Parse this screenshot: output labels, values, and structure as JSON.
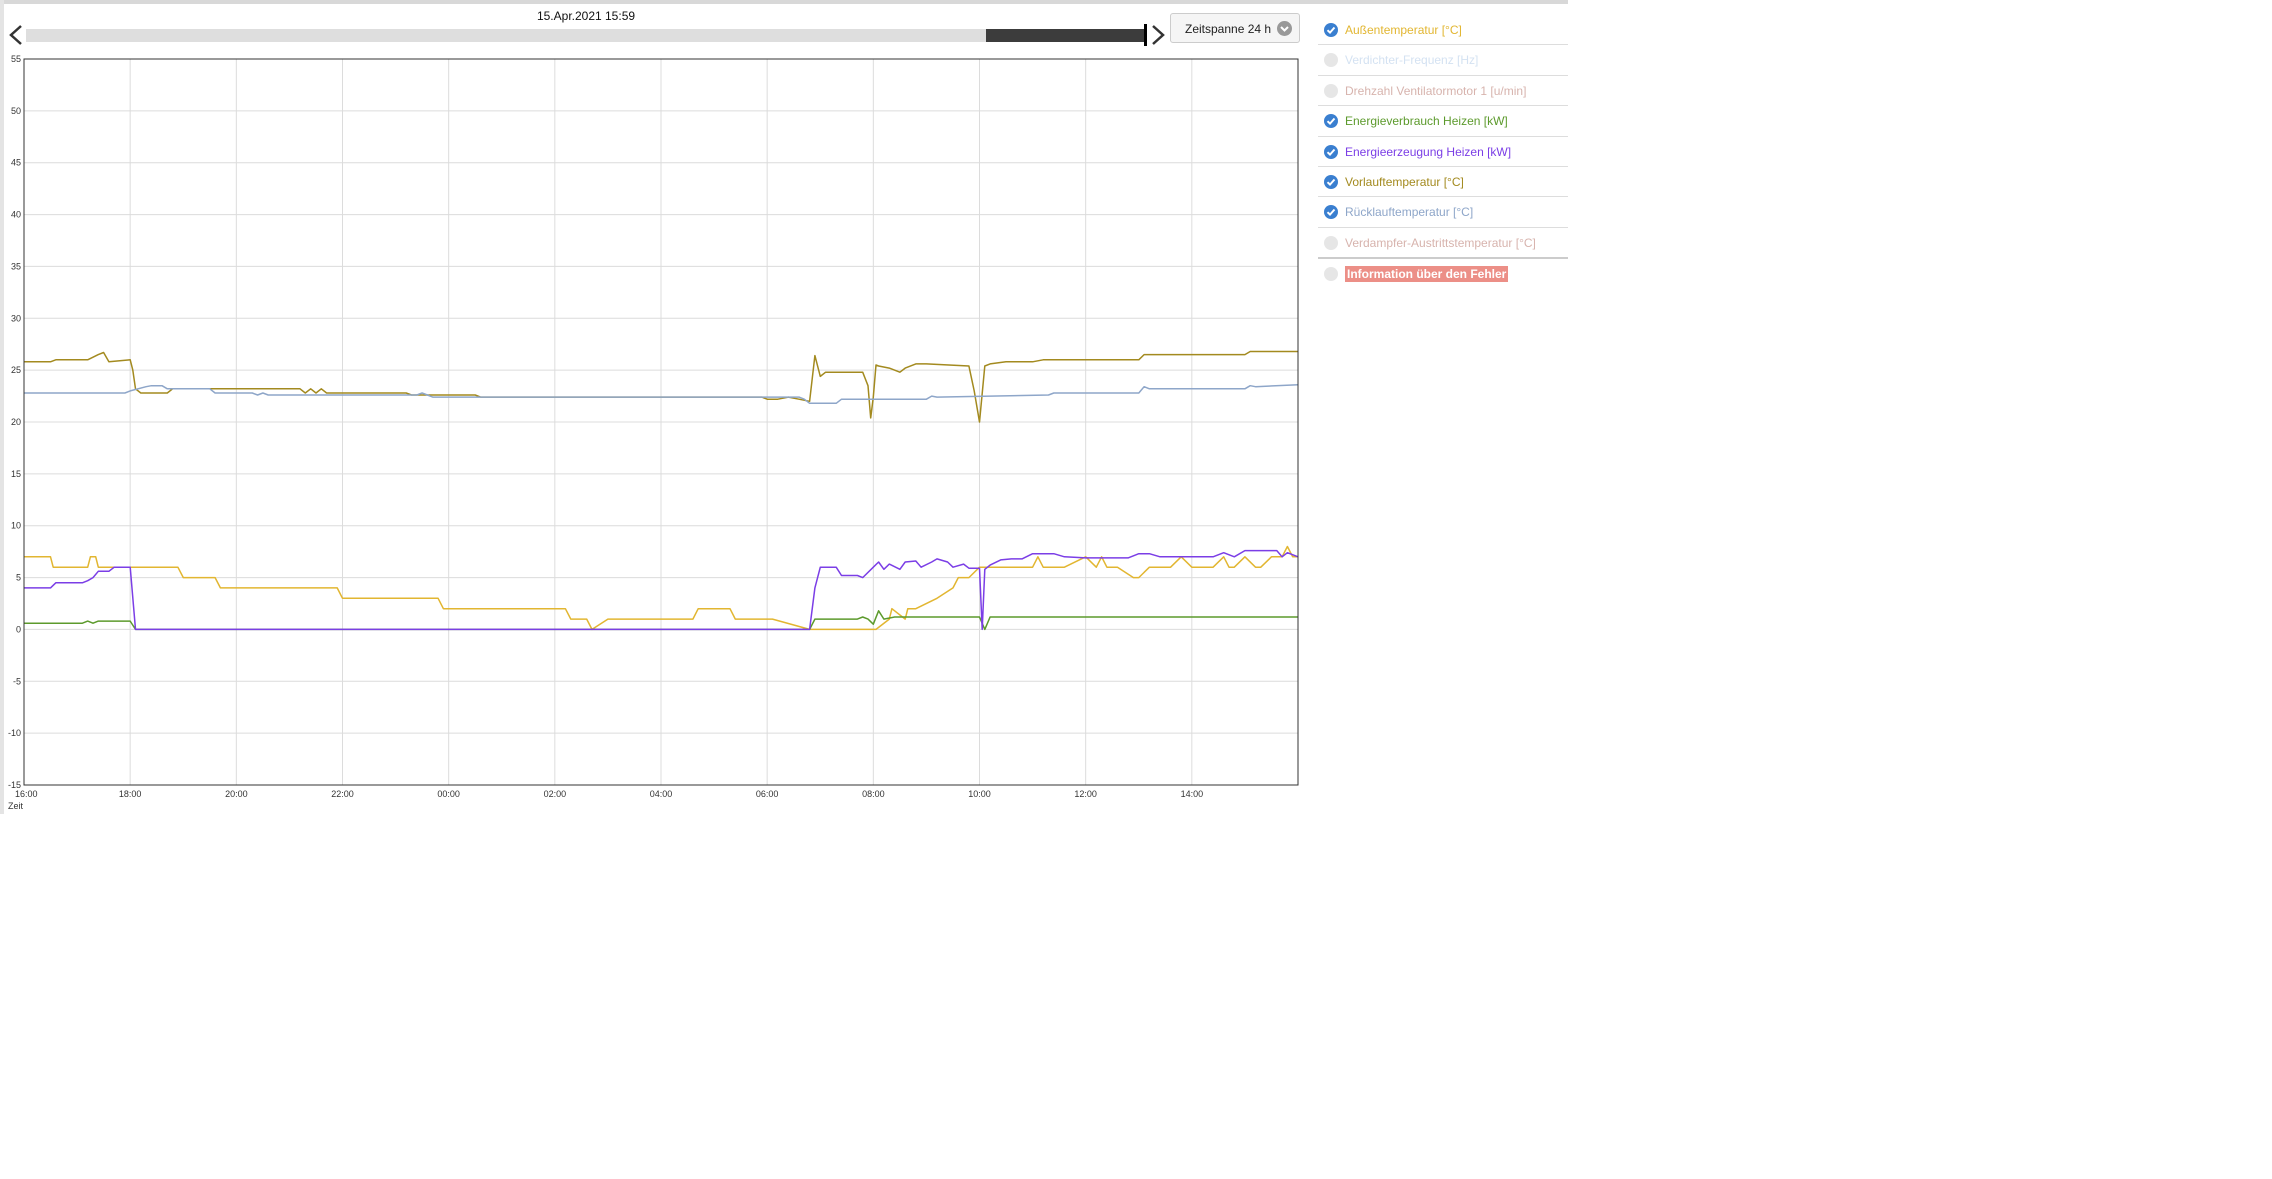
{
  "header": {
    "date_label": "15.Apr.2021 15:59",
    "timespan_label": "Zeitspanne 24 h"
  },
  "slider": {
    "window_start_fraction": 0.857,
    "window_end_fraction": 1.0
  },
  "legend": [
    {
      "label": "Außentemperatur [°C]",
      "checked": true,
      "color": "#e2b631"
    },
    {
      "label": "Verdichter-Frequenz [Hz]",
      "checked": false,
      "color": "#d4e2f2"
    },
    {
      "label": "Drehzahl Ventilatormotor 1 [u/min]",
      "checked": false,
      "color": "#d7b3ad"
    },
    {
      "label": "Energieverbrauch Heizen [kW]",
      "checked": true,
      "color": "#5c9a2c"
    },
    {
      "label": "Energieerzeugung Heizen [kW]",
      "checked": true,
      "color": "#7b3ee6"
    },
    {
      "label": "Vorlauftemperatur [°C]",
      "checked": true,
      "color": "#a38a1f"
    },
    {
      "label": "Rücklauftemperatur [°C]",
      "checked": true,
      "color": "#8ea6c9"
    },
    {
      "label": "Verdampfer-Austrittstemperatur [°C]",
      "checked": false,
      "color": "#d7b3ad"
    },
    {
      "label": "Information über den Fehler",
      "checked": false,
      "color": "#ec8f87",
      "badge": true
    }
  ],
  "chart_data": {
    "type": "line",
    "xlabel": "Zeit",
    "ylim": [
      -15,
      55
    ],
    "yticks": [
      -15,
      -10,
      -5,
      0,
      5,
      10,
      15,
      20,
      25,
      30,
      35,
      40,
      45,
      50,
      55
    ],
    "xlim": [
      0,
      24
    ],
    "xticks": [
      {
        "pos": 0,
        "label": "16:00"
      },
      {
        "pos": 2,
        "label": "18:00"
      },
      {
        "pos": 4,
        "label": "20:00"
      },
      {
        "pos": 6,
        "label": "22:00"
      },
      {
        "pos": 8,
        "label": "00:00"
      },
      {
        "pos": 10,
        "label": "02:00"
      },
      {
        "pos": 12,
        "label": "04:00"
      },
      {
        "pos": 14,
        "label": "06:00"
      },
      {
        "pos": 16,
        "label": "08:00"
      },
      {
        "pos": 18,
        "label": "10:00"
      },
      {
        "pos": 20,
        "label": "12:00"
      },
      {
        "pos": 22,
        "label": "14:00"
      }
    ],
    "grid": true,
    "series": [
      {
        "name": "Außentemperatur [°C]",
        "color": "#e2b631",
        "x": [
          0,
          0.5,
          0.55,
          1.2,
          1.25,
          1.35,
          1.4,
          2.9,
          3.0,
          3.6,
          3.7,
          5.9,
          6.0,
          7.8,
          7.9,
          10.2,
          10.3,
          10.6,
          10.7,
          11.0,
          12.6,
          12.7,
          13.3,
          13.4,
          13.5,
          14.1,
          14.8,
          15.6,
          15.7,
          15.9,
          16.05,
          16.3,
          16.35,
          16.6,
          16.65,
          16.8,
          17.2,
          17.5,
          17.6,
          17.8,
          18.0,
          18.2,
          18.4,
          18.5,
          19.0,
          19.1,
          19.2,
          19.4,
          19.6,
          20.0,
          20.2,
          20.3,
          20.4,
          20.6,
          20.9,
          21.0,
          21.2,
          21.4,
          21.6,
          21.8,
          22.0,
          22.4,
          22.6,
          22.7,
          22.8,
          23.0,
          23.2,
          23.3,
          23.5,
          23.7,
          23.8,
          23.9,
          24.0
        ],
        "y": [
          7,
          7,
          6,
          6,
          7,
          7,
          6,
          6,
          5,
          5,
          4,
          4,
          3,
          3,
          2,
          2,
          1,
          1,
          0,
          1,
          1,
          2,
          2,
          1,
          1,
          1,
          0,
          0,
          0,
          0,
          0,
          1,
          2,
          1,
          2,
          2,
          3,
          4,
          5,
          5,
          6,
          6,
          6,
          6,
          6,
          7,
          6,
          6,
          6,
          7,
          6,
          7,
          6,
          6,
          5,
          5,
          6,
          6,
          6,
          7,
          6,
          6,
          7,
          6,
          6,
          7,
          6,
          6,
          7,
          7,
          8,
          7,
          7
        ]
      },
      {
        "name": "Energieverbrauch Heizen [kW]",
        "color": "#5c9a2c",
        "x": [
          0,
          1.1,
          1.2,
          1.3,
          1.4,
          2.0,
          2.1,
          14.8,
          14.9,
          15.7,
          15.8,
          15.9,
          16.0,
          16.1,
          16.2,
          16.4,
          16.6,
          16.7,
          17.5,
          18.0,
          18.1,
          18.2,
          24.0
        ],
        "y": [
          0.6,
          0.6,
          0.8,
          0.6,
          0.8,
          0.8,
          0,
          0,
          1.0,
          1.0,
          1.2,
          1.0,
          0.5,
          1.8,
          1.0,
          1.2,
          1.2,
          1.2,
          1.2,
          1.2,
          0,
          1.2,
          1.2
        ]
      },
      {
        "name": "Energieerzeugung Heizen [kW]",
        "color": "#7b3ee6",
        "x": [
          0,
          0.5,
          0.6,
          1.1,
          1.2,
          1.3,
          1.4,
          1.6,
          1.7,
          2.0,
          2.1,
          14.7,
          14.8,
          14.9,
          15.0,
          15.3,
          15.4,
          15.7,
          15.8,
          16.0,
          16.1,
          16.2,
          16.3,
          16.5,
          16.6,
          16.8,
          16.9,
          17.1,
          17.2,
          17.4,
          17.5,
          17.7,
          17.8,
          18.0,
          18.05,
          18.1,
          18.2,
          18.4,
          18.6,
          18.8,
          19.0,
          19.4,
          19.6,
          20.0,
          20.4,
          20.6,
          20.8,
          21.0,
          21.2,
          21.4,
          21.6,
          21.8,
          22.0,
          22.4,
          22.6,
          22.8,
          23.0,
          23.2,
          23.6,
          23.7,
          23.8,
          24.0
        ],
        "y": [
          4,
          4,
          4.5,
          4.5,
          4.7,
          5.0,
          5.6,
          5.6,
          6,
          6,
          0,
          0,
          0,
          4,
          6,
          6,
          5.2,
          5.2,
          5,
          6,
          6.5,
          5.8,
          6.3,
          5.8,
          6.5,
          6.6,
          6.0,
          6.5,
          6.8,
          6.5,
          6.0,
          6.3,
          5.9,
          5.9,
          0,
          5.8,
          6.2,
          6.7,
          6.8,
          6.8,
          7.3,
          7.3,
          7.0,
          6.9,
          6.9,
          6.9,
          6.9,
          7.3,
          7.3,
          7.0,
          7.0,
          7.0,
          7.0,
          7.0,
          7.4,
          7.0,
          7.6,
          7.6,
          7.6,
          7.0,
          7.4,
          7.0
        ]
      },
      {
        "name": "Vorlauftemperatur [°C]",
        "color": "#a38a1f",
        "x": [
          0,
          0.5,
          0.6,
          1.2,
          1.4,
          1.5,
          1.6,
          2.0,
          2.05,
          2.1,
          2.2,
          2.7,
          2.8,
          3.4,
          3.5,
          5.2,
          5.3,
          5.4,
          5.5,
          5.6,
          5.7,
          7.2,
          7.3,
          8.5,
          8.6,
          13.9,
          14.0,
          14.2,
          14.4,
          14.6,
          14.8,
          14.9,
          15.0,
          15.1,
          15.8,
          15.9,
          15.95,
          16.0,
          16.05,
          16.1,
          16.3,
          16.5,
          16.6,
          16.8,
          17.0,
          17.8,
          17.9,
          18.0,
          18.1,
          18.2,
          18.5,
          19.0,
          19.2,
          20.0,
          21.0,
          21.1,
          22.0,
          23.0,
          23.1,
          24.0
        ],
        "y": [
          25.8,
          25.8,
          26,
          26,
          26.5,
          26.7,
          25.8,
          26,
          25,
          23.2,
          22.8,
          22.8,
          23.2,
          23.2,
          23.2,
          23.2,
          22.8,
          23.2,
          22.8,
          23.2,
          22.8,
          22.8,
          22.6,
          22.6,
          22.4,
          22.4,
          22.2,
          22.2,
          22.4,
          22.2,
          22.0,
          26.4,
          24.4,
          24.8,
          24.8,
          23.5,
          20.4,
          22.4,
          25.5,
          25.4,
          25.2,
          24.8,
          25.2,
          25.6,
          25.6,
          25.4,
          23.0,
          20.0,
          25.4,
          25.6,
          25.8,
          25.8,
          26.0,
          26.0,
          26.0,
          26.5,
          26.5,
          26.5,
          26.8,
          26.8
        ]
      },
      {
        "name": "Rücklauftemperatur [°C]",
        "color": "#8ea6c9",
        "x": [
          0,
          1.9,
          2.0,
          2.3,
          2.4,
          2.6,
          2.7,
          3.5,
          3.6,
          4.3,
          4.4,
          4.5,
          4.6,
          7.4,
          7.5,
          7.6,
          7.7,
          14.6,
          14.7,
          14.8,
          15.3,
          15.4,
          17.0,
          17.1,
          17.2,
          19.3,
          19.4,
          21.0,
          21.1,
          21.2,
          23.0,
          23.1,
          23.2,
          24.0
        ],
        "y": [
          22.8,
          22.8,
          23.0,
          23.4,
          23.5,
          23.5,
          23.2,
          23.2,
          22.8,
          22.8,
          22.6,
          22.8,
          22.6,
          22.6,
          22.8,
          22.6,
          22.4,
          22.4,
          22.2,
          21.8,
          21.8,
          22.2,
          22.2,
          22.5,
          22.4,
          22.6,
          22.8,
          22.8,
          23.4,
          23.2,
          23.2,
          23.5,
          23.4,
          23.6
        ]
      }
    ]
  }
}
